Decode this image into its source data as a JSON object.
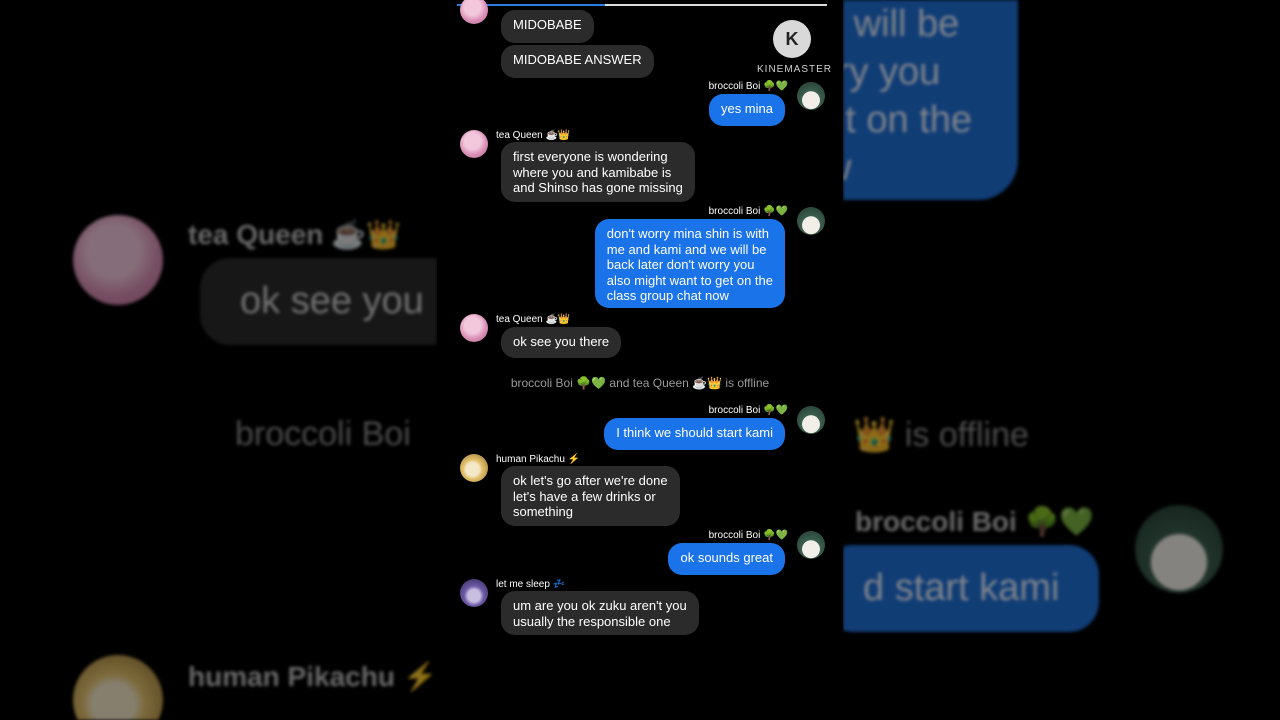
{
  "video": {
    "progress": 0.4
  },
  "watermark": {
    "letter": "K",
    "text": "KINEMASTER"
  },
  "background_echo": {
    "left_name": "tea Queen ☕👑",
    "left_bubble": "ok see you",
    "left_system": "broccoli Boi",
    "left_name_2": "human Pikachu ⚡",
    "right_lines": [
      "ve will be",
      "orry you",
      "get on the",
      "ow"
    ],
    "right_system": "👑 is offline",
    "right_name": "broccoli Boi 🌳💚",
    "right_bubble": "d start kami"
  },
  "chat": {
    "messages": [
      {
        "side": "in",
        "sender": "",
        "lines": [
          "MIDOBABE"
        ]
      },
      {
        "side": "in",
        "sender": "",
        "lines": [
          "MIDOBABE ANSWER"
        ]
      },
      {
        "side": "out",
        "sender": "broccoli Boi 🌳💚",
        "lines": [
          "yes mina"
        ]
      },
      {
        "side": "in",
        "sender": "tea Queen ☕👑",
        "lines": [
          "first everyone is wondering",
          "where you and kamibabe is",
          "and Shinso has gone missing"
        ]
      },
      {
        "side": "out",
        "sender": "broccoli Boi 🌳💚",
        "lines": [
          "don't worry mina shin is with",
          "me and kami and we will be",
          "back later don't worry you",
          "also might want to get on the",
          "class group chat now"
        ]
      },
      {
        "side": "in",
        "sender": "tea Queen ☕👑",
        "lines": [
          "ok see you there"
        ]
      },
      {
        "side": "system",
        "text": "broccoli Boi 🌳💚 and tea Queen ☕👑 is offline"
      },
      {
        "side": "out",
        "sender": "broccoli Boi 🌳💚",
        "lines": [
          "I think we should start kami"
        ]
      },
      {
        "side": "in",
        "sender": "human Pikachu ⚡",
        "lines": [
          "ok let's go after we're done",
          "let's have a few drinks or",
          "something"
        ]
      },
      {
        "side": "out",
        "sender": "broccoli Boi 🌳💚",
        "lines": [
          "ok sounds great"
        ]
      },
      {
        "side": "in",
        "sender": "let me sleep 💤",
        "lines": [
          "um are you ok zuku aren't you",
          "usually the responsible one"
        ]
      }
    ]
  },
  "colors": {
    "incoming_bubble": "#2b2b2b",
    "outgoing_bubble": "#1a73e8",
    "background": "#000000"
  }
}
